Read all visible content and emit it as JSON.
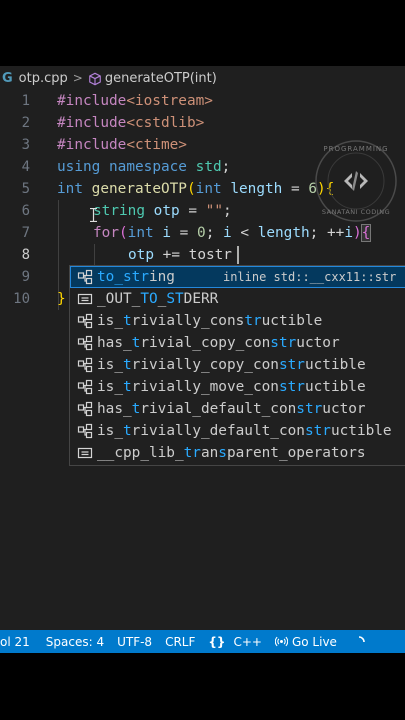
{
  "breadcrumb": {
    "file": "otp.cpp",
    "symbol": "generateOTP(int)"
  },
  "gutter": [
    "1",
    "2",
    "3",
    "4",
    "5",
    "6",
    "7",
    "8",
    "9",
    "10"
  ],
  "code": {
    "l1_directive": "#include",
    "l1_header": "<iostream>",
    "l2_directive": "#include",
    "l2_header": "<cstdlib>",
    "l3_directive": "#include",
    "l3_header": "<ctime>",
    "l4_using": "using",
    "l4_namespace": "namespace",
    "l4_std": "std",
    "l4_semi": ";",
    "l5_int": "int",
    "l5_fn": "generateOTP",
    "l5_open": "(",
    "l5_ptype": "int",
    "l5_pname": "length",
    "l5_eq": " = ",
    "l5_default": "6",
    "l5_close": ")",
    "l5_brace": "{",
    "l6_type": "string",
    "l6_var": "otp",
    "l6_eq": " = ",
    "l6_str": "\"\"",
    "l6_semi": ";",
    "l7_for": "for",
    "l7_open": "(",
    "l7_int": "int",
    "l7_i1": "i",
    "l7_eq": " = ",
    "l7_zero": "0",
    "l7_s1": "; ",
    "l7_i2": "i",
    "l7_lt": " < ",
    "l7_len": "length",
    "l7_s2": "; ++",
    "l7_i3": "i",
    "l7_close": ")",
    "l7_brace": "{",
    "l8_var": "otp",
    "l8_rest": " += tostr",
    "l10_brace": "}"
  },
  "suggestions": [
    {
      "pre": "",
      "m1": "to_str",
      "mid": "",
      "m2": "",
      "post": "ing",
      "icon": "symbol-class-icon",
      "detail": "inline std::__cxx11::str"
    },
    {
      "pre": "_OUT_",
      "m1": "TO",
      "mid": "_",
      "m2": "ST",
      "post": "DERR",
      "icon": "symbol-constant-icon",
      "detail": ""
    },
    {
      "pre": "is_",
      "m1": "t",
      "mid": "rivially_cons",
      "m2": "tr",
      "post": "uctible",
      "icon": "symbol-class-icon",
      "detail": ""
    },
    {
      "pre": "has_",
      "m1": "t",
      "mid": "rivial_copy_con",
      "m2": "str",
      "post": "uctor",
      "icon": "symbol-class-icon",
      "detail": ""
    },
    {
      "pre": "is_",
      "m1": "t",
      "mid": "rivially_copy_con",
      "m2": "str",
      "post": "uctible",
      "icon": "symbol-class-icon",
      "detail": ""
    },
    {
      "pre": "is_",
      "m1": "t",
      "mid": "rivially_move_con",
      "m2": "str",
      "post": "uctible",
      "icon": "symbol-class-icon",
      "detail": ""
    },
    {
      "pre": "has_",
      "m1": "t",
      "mid": "rivial_default_con",
      "m2": "str",
      "post": "uctor",
      "icon": "symbol-class-icon",
      "detail": ""
    },
    {
      "pre": "is_",
      "m1": "t",
      "mid": "rivially_default_con",
      "m2": "str",
      "post": "uctible",
      "icon": "symbol-class-icon",
      "detail": ""
    },
    {
      "pre": "__cpp_lib_",
      "m1": "tr",
      "mid": "an",
      "m2": "s",
      "post": "parent_operators",
      "icon": "symbol-constant-icon",
      "detail": ""
    }
  ],
  "status": {
    "position": "ol 21",
    "spaces": "Spaces: 4",
    "encoding": "UTF-8",
    "eol": "CRLF",
    "braces": "{}",
    "language": "C++",
    "golive": "Go Live"
  },
  "watermark": {
    "top_text": "PROGRAMMING",
    "bottom_text": "SANATANI CODING"
  },
  "colors": {
    "editor_bg": "#1f1f1f",
    "statusbar": "#007acc",
    "selection": "#04395e",
    "match": "#2aaaff"
  }
}
